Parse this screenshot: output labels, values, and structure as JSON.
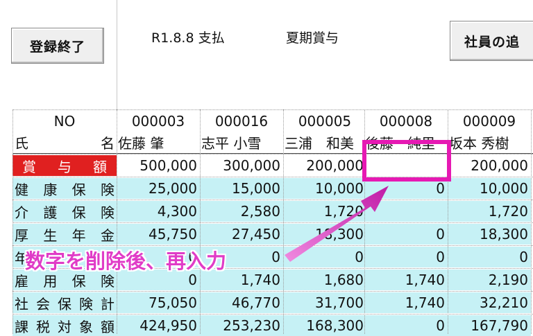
{
  "toolbar": {
    "finish_label": "登録終了",
    "date_text": "R1.8.8 支払",
    "type_text": "夏期賞与",
    "add_label": "社員の追"
  },
  "table": {
    "no_label": "NO",
    "name_label_left": "氏",
    "name_label_right": "名",
    "employees": [
      {
        "no": "000003",
        "name": "佐藤 肇"
      },
      {
        "no": "000016",
        "name": "志平 小雪"
      },
      {
        "no": "000005",
        "name": "三浦　和美"
      },
      {
        "no": "000008",
        "name": "後藤　純里"
      },
      {
        "no": "000009",
        "name": "坂本 秀樹"
      }
    ],
    "rows": [
      {
        "label": "賞与額",
        "values": [
          "500,000",
          "300,000",
          "200,000",
          "",
          "200,000"
        ]
      },
      {
        "label": "健康保険",
        "values": [
          "25,000",
          "15,000",
          "10,000",
          "0",
          "10,000"
        ]
      },
      {
        "label": "介護保険",
        "values": [
          "4,300",
          "2,580",
          "1,720",
          "",
          "1,720"
        ]
      },
      {
        "label": "厚生年金",
        "values": [
          "45,750",
          "27,450",
          "18,300",
          "0",
          "18,300"
        ]
      },
      {
        "label": "年金",
        "values": [
          "0",
          "0",
          "0",
          "0",
          "0"
        ]
      },
      {
        "label": "雇用保険",
        "values": [
          "0",
          "1,740",
          "1,680",
          "1,740",
          "2,190"
        ]
      },
      {
        "label": "社会保険計",
        "values": [
          "75,050",
          "46,770",
          "31,700",
          "1,740",
          "32,210"
        ]
      },
      {
        "label": "課税対象額",
        "values": [
          "424,950",
          "253,230",
          "168,300",
          "0",
          "167,790"
        ]
      }
    ]
  },
  "annotation": {
    "text": "数字を削除後、再入力",
    "color": "#e619b3"
  },
  "colors": {
    "header_red": "#e02020",
    "row_cyan": "#c6f1f5"
  }
}
